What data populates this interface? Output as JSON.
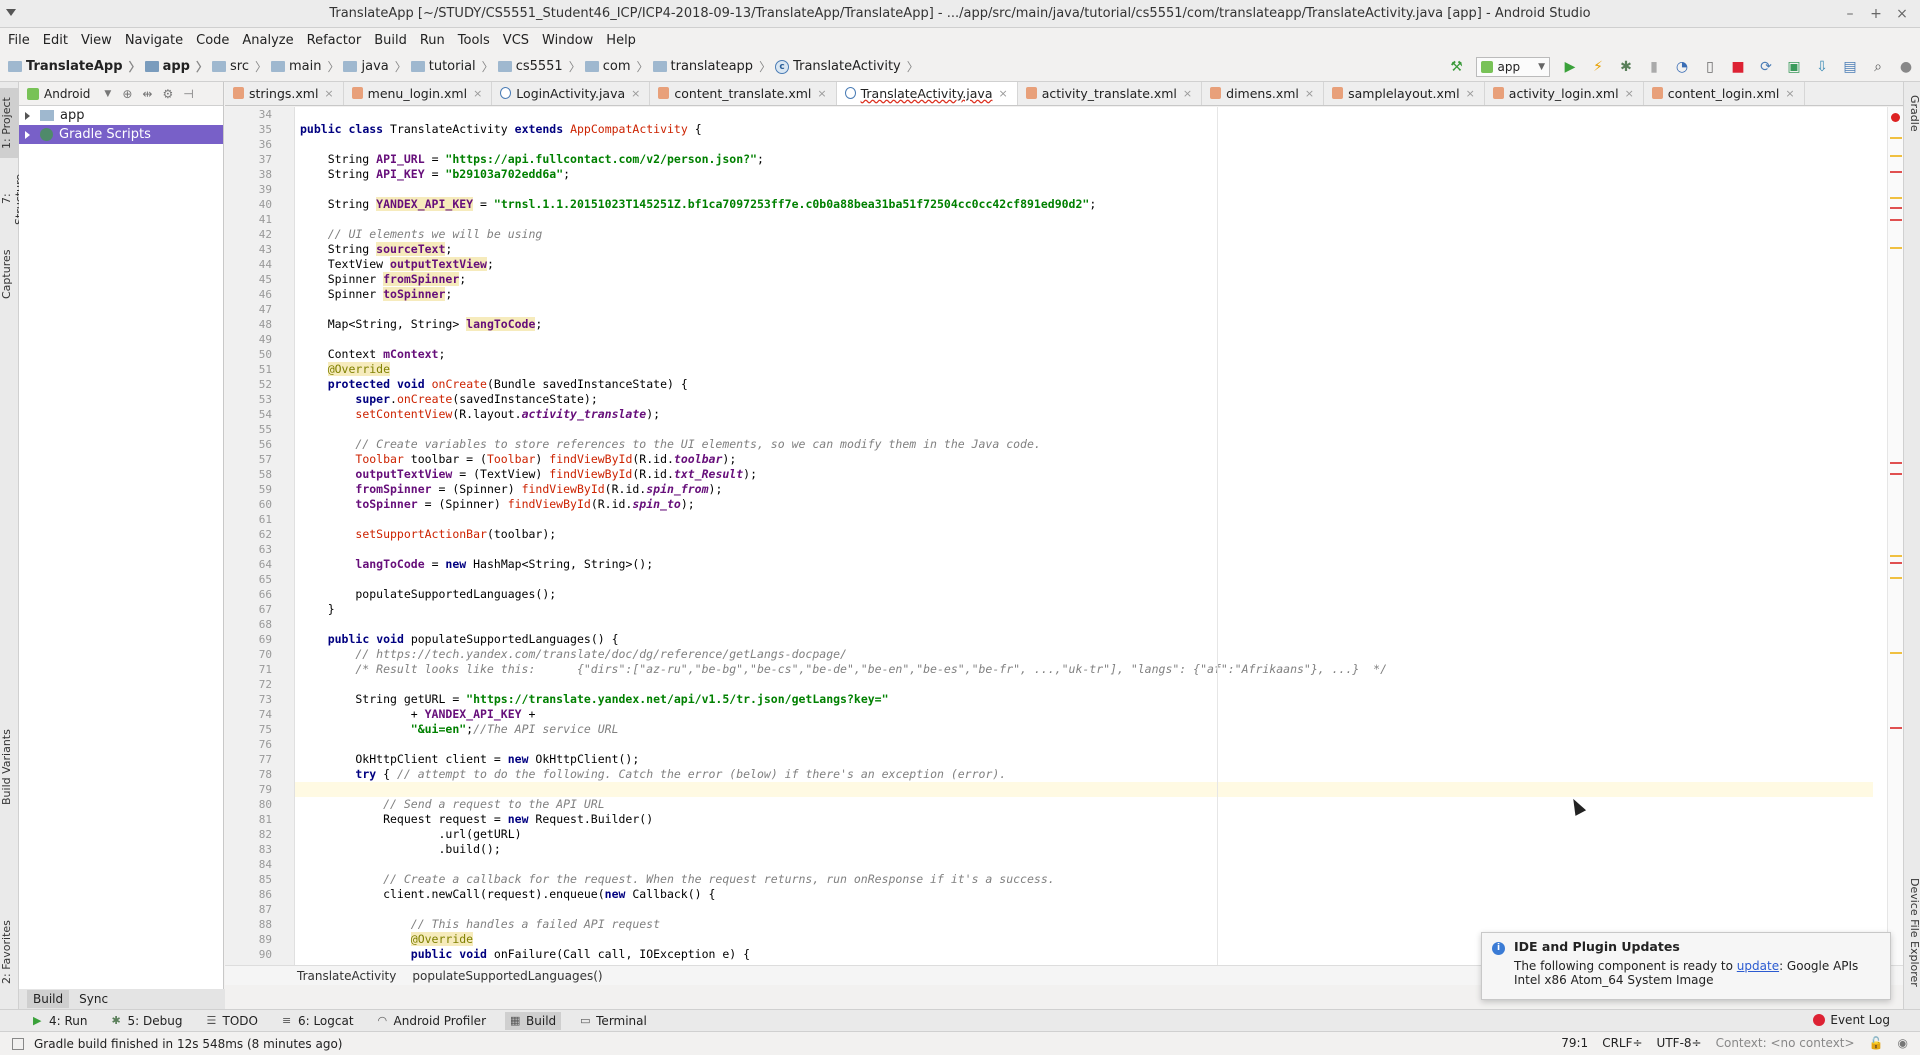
{
  "window": {
    "title": "TranslateApp [~/STUDY/CS5551_Student46_ICP/ICP4-2018-09-13/TranslateApp/TranslateApp] - .../app/src/main/java/tutorial/cs5551/com/translateapp/TranslateActivity.java [app] - Android Studio"
  },
  "menu": [
    "File",
    "Edit",
    "View",
    "Navigate",
    "Code",
    "Analyze",
    "Refactor",
    "Build",
    "Run",
    "Tools",
    "VCS",
    "Window",
    "Help"
  ],
  "nav": {
    "crumbs": [
      "TranslateApp",
      "app",
      "src",
      "main",
      "java",
      "tutorial",
      "cs5551",
      "com",
      "translateapp",
      "TranslateActivity"
    ],
    "run_config": "app"
  },
  "left_tabs": [
    "1: Project",
    "7: Structure",
    "Captures",
    "Build Variants",
    "2: Favorites"
  ],
  "right_tabs": [
    "Gradle",
    "Device File Explorer"
  ],
  "project_panel": {
    "view": "Android",
    "items": [
      "app",
      "Gradle Scripts"
    ]
  },
  "editor_tabs": [
    {
      "name": "strings.xml",
      "type": "xml"
    },
    {
      "name": "menu_login.xml",
      "type": "xml"
    },
    {
      "name": "LoginActivity.java",
      "type": "java"
    },
    {
      "name": "content_translate.xml",
      "type": "xml"
    },
    {
      "name": "TranslateActivity.java",
      "type": "java",
      "active": true
    },
    {
      "name": "activity_translate.xml",
      "type": "xml"
    },
    {
      "name": "dimens.xml",
      "type": "xml"
    },
    {
      "name": "samplelayout.xml",
      "type": "xml"
    },
    {
      "name": "activity_login.xml",
      "type": "xml"
    },
    {
      "name": "content_login.xml",
      "type": "xml"
    }
  ],
  "code": {
    "first_line": 34,
    "current_line": 79,
    "lines": [
      "",
      "public class TranslateActivity extends AppCompatActivity {",
      "",
      "    String API_URL = \"https://api.fullcontact.com/v2/person.json?\";",
      "    String API_KEY = \"b29103a702edd6a\";",
      "",
      "    String YANDEX_API_KEY = \"trnsl.1.1.20151023T145251Z.bf1ca7097253ff7e.c0b0a88bea31ba51f72504cc0cc42cf891ed90d2\";",
      "",
      "    // UI elements we will be using",
      "    String sourceText;",
      "    TextView outputTextView;",
      "    Spinner fromSpinner;",
      "    Spinner toSpinner;",
      "",
      "    Map<String, String> langToCode;",
      "",
      "    Context mContext;",
      "    @Override",
      "    protected void onCreate(Bundle savedInstanceState) {",
      "        super.onCreate(savedInstanceState);",
      "        setContentView(R.layout.activity_translate);",
      "",
      "        // Create variables to store references to the UI elements, so we can modify them in the Java code.",
      "        Toolbar toolbar = (Toolbar) findViewById(R.id.toolbar);",
      "        outputTextView = (TextView) findViewById(R.id.txt_Result);",
      "        fromSpinner = (Spinner) findViewById(R.id.spin_from);",
      "        toSpinner = (Spinner) findViewById(R.id.spin_to);",
      "",
      "        setSupportActionBar(toolbar);",
      "",
      "        langToCode = new HashMap<String, String>();",
      "",
      "        populateSupportedLanguages();",
      "    }",
      "",
      "    public void populateSupportedLanguages() {",
      "        // https://tech.yandex.com/translate/doc/dg/reference/getLangs-docpage/",
      "        /* Result looks like this:      {\"dirs\":[\"az-ru\",\"be-bg\",\"be-cs\",\"be-de\",\"be-en\",\"be-es\",\"be-fr\", ...,\"uk-tr\"], \"langs\": {\"af\":\"Afrikaans\"}, ...}  */",
      "",
      "        String getURL = \"https://translate.yandex.net/api/v1.5/tr.json/getLangs?key=\"",
      "                + YANDEX_API_KEY +",
      "                \"&ui=en\";//The API service URL",
      "",
      "        OkHttpClient client = new OkHttpClient();",
      "        try { // attempt to do the following. Catch the error (below) if there's an exception (error).",
      "",
      "            // Send a request to the API URL",
      "            Request request = new Request.Builder()",
      "                    .url(getURL)",
      "                    .build();",
      "",
      "            // Create a callback for the request. When the request returns, run onResponse if it's a success.",
      "            client.newCall(request).enqueue(new Callback() {",
      "",
      "                // This handles a failed API request",
      "                @Override",
      "                public void onFailure(Call call, IOException e) {"
    ]
  },
  "editor_breadcrumb": [
    "TranslateActivity",
    "populateSupportedLanguages()"
  ],
  "bottom_panel_tabs": [
    "Build",
    "Sync"
  ],
  "tool_windows": [
    "4: Run",
    "5: Debug",
    "TODO",
    "6: Logcat",
    "Android Profiler",
    "Build",
    "Terminal"
  ],
  "event_log": "Event Log",
  "status": {
    "message": "Gradle build finished in 12s 548ms (8 minutes ago)",
    "position": "79:1",
    "line_sep": "CRLF÷",
    "encoding": "UTF-8÷",
    "context": "Context: <no context>"
  },
  "notification": {
    "title": "IDE and Plugin Updates",
    "text_before": "The following component is ready to ",
    "link": "update",
    "text_after": ": Google APIs Intel x86 Atom_64 System Image"
  },
  "colors": {
    "accent_selection": "#7860c8",
    "keyword": "#000080",
    "string": "#008000",
    "comment": "#808080",
    "field": "#660e7a"
  }
}
